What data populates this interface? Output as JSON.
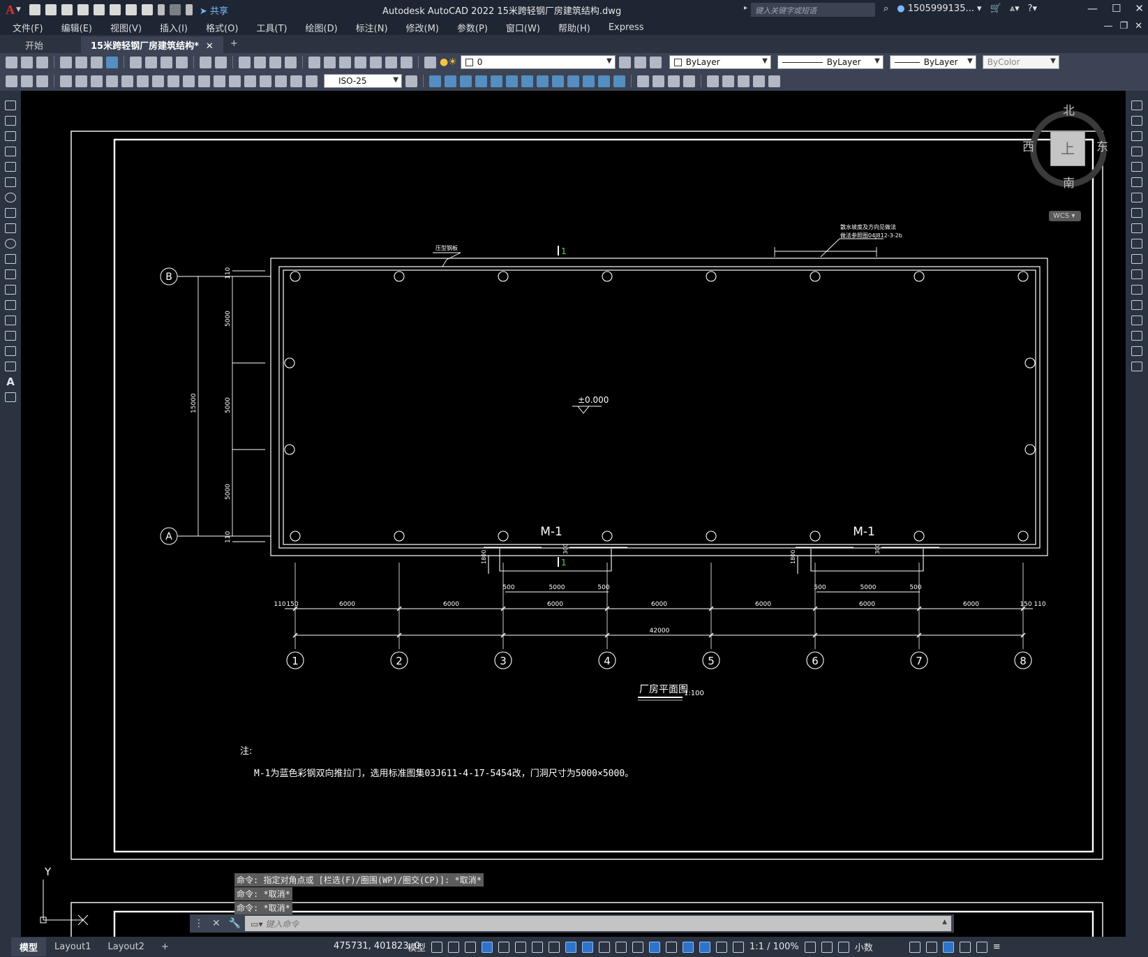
{
  "app": {
    "logo": "A",
    "title": "Autodesk AutoCAD 2022    15米跨轻钢厂房建筑结构.dwg",
    "share": "共享",
    "search_placeholder": "键入关键字或短语",
    "user": "1505999135...",
    "window_controls": [
      "—",
      "☐",
      "✕"
    ]
  },
  "menu": [
    "文件(F)",
    "编辑(E)",
    "视图(V)",
    "插入(I)",
    "格式(O)",
    "工具(T)",
    "绘图(D)",
    "标注(N)",
    "修改(M)",
    "参数(P)",
    "窗口(W)",
    "帮助(H)",
    "Express"
  ],
  "tabs": [
    {
      "label": "开始"
    },
    {
      "label": "15米跨轻钢厂房建筑结构*",
      "active": true
    }
  ],
  "properties": {
    "layer": "0",
    "color": "ByLayer",
    "linetype": "ByLayer",
    "lineweight": "ByLayer",
    "plotstyle": "ByColor",
    "dimstyle": "ISO-25"
  },
  "viewcube": {
    "north": "北",
    "south": "南",
    "west": "西",
    "east": "东",
    "top": "上",
    "wcs": "WCS"
  },
  "drawing": {
    "grid_cols": [
      "1",
      "2",
      "3",
      "4",
      "5",
      "6",
      "7",
      "8"
    ],
    "grid_rows": [
      "B",
      "A"
    ],
    "elevation": "±0.000",
    "door_tag": "M-1",
    "section_mark": "1",
    "title": "厂房平面图",
    "scale": "1:100",
    "note_title": "注:",
    "note_text": "M-1为蓝色彩钢双向推拉门，选用标准图集03J611-4-17-5454改，门洞尺寸为5000×5000。",
    "label_roof": "压型钢板",
    "label_gutter": "散水坡度及方向见做法",
    "label_gutter2": "做法参照图04J812-3-2b",
    "dims": {
      "bays": [
        "6000",
        "6000",
        "6000",
        "6000",
        "6000",
        "6000",
        "6000"
      ],
      "total": "42000",
      "edge_left": [
        "110",
        "150"
      ],
      "edge_right": [
        "150",
        "110"
      ],
      "door_opening": "5000",
      "door_side": "500",
      "door_depth": "1800",
      "door_step": "300",
      "span_parts": [
        "5000",
        "5000",
        "5000"
      ],
      "span_total": "15000",
      "span_edge": "110"
    },
    "ucs_y": "Y"
  },
  "command": {
    "history": [
      "命令: 指定对角点或 [栏选(F)/圈围(WP)/圈交(CP)]: *取消*",
      "命令: *取消*",
      "命令: *取消*"
    ],
    "placeholder": "键入命令"
  },
  "status": {
    "layouts": [
      "模型",
      "Layout1",
      "Layout2"
    ],
    "coords": "475731, 401823, 0",
    "space": "模型",
    "scale": "1:1 / 100%",
    "units": "小数"
  }
}
